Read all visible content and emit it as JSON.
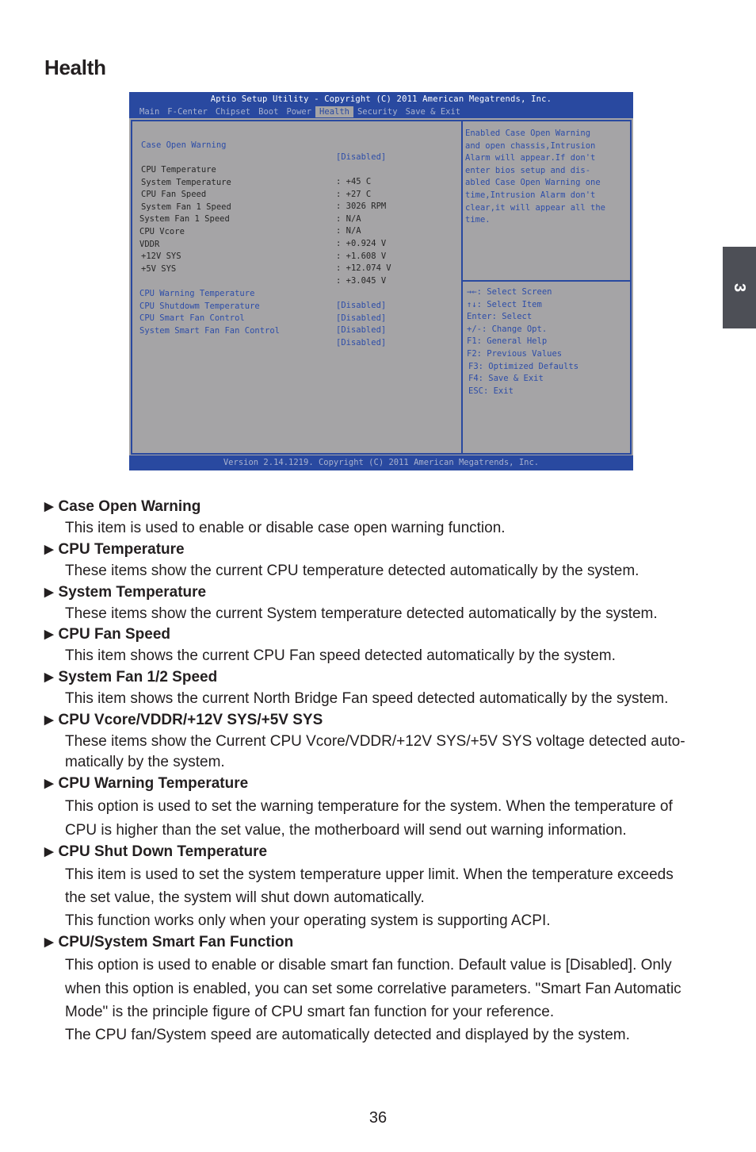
{
  "page": {
    "title": "Health",
    "chapter_tab": "3",
    "page_number": "36"
  },
  "bios": {
    "title": "Aptio Setup Utility - Copyright (C) 2011 American Megatrends, Inc.",
    "menu": [
      {
        "label": "Main",
        "active": false
      },
      {
        "label": "F-Center",
        "active": false
      },
      {
        "label": "Chipset",
        "active": false
      },
      {
        "label": "Boot",
        "active": false
      },
      {
        "label": "Power",
        "active": false
      },
      {
        "label": "Health",
        "active": true
      },
      {
        "label": "Security",
        "active": false
      },
      {
        "label": "Save & Exit",
        "active": false
      }
    ],
    "items": [
      {
        "label": "Case Open Warning",
        "value": "[Disabled]"
      },
      {
        "label": "CPU Temperature",
        "value": ": +45 C"
      },
      {
        "label": "System Temperature",
        "value": ": +27 C"
      },
      {
        "label": "CPU Fan Speed",
        "value": ": 3026 RPM"
      },
      {
        "label": "System Fan 1 Speed",
        "value": ": N/A"
      },
      {
        "label": "System Fan 1 Speed",
        "value": ": N/A"
      },
      {
        "label": "CPU Vcore",
        "value": ": +0.924 V"
      },
      {
        "label": "VDDR",
        "value": ": +1.608 V"
      },
      {
        "label": "+12V SYS",
        "value": ": +12.074 V"
      },
      {
        "label": "+5V SYS",
        "value": ": +3.045 V"
      },
      {
        "label": "CPU Warning Temperature",
        "value": "[Disabled]"
      },
      {
        "label": "CPU Shutdowm Temperature",
        "value": "[Disabled]"
      },
      {
        "label": "CPU Smart Fan Control",
        "value": "[Disabled]"
      },
      {
        "label": "System Smart Fan Fan Control",
        "value": "[Disabled]"
      }
    ],
    "help_text": [
      "Enabled Case Open Warning",
      "and open chassis,Intrusion",
      "Alarm will appear.If don't",
      "enter bios setup and dis-",
      "abled Case Open Warning one",
      "time,Intrusion Alarm don't",
      "clear,it will appear all the",
      "time."
    ],
    "key_help": [
      "→←: Select Screen",
      "↑↓: Select Item",
      "Enter: Select",
      "+/-: Change Opt.",
      "F1: General Help",
      "F2: Previous Values",
      "F3: Optimized Defaults",
      "F4: Save & Exit",
      "ESC: Exit"
    ],
    "footer": "Version 2.14.1219. Copyright (C) 2011 American Megatrends, Inc.",
    "colors": {
      "bar": "#2949a0",
      "panel": "#a5a4a6",
      "highlight_text": "#2d4da8"
    }
  },
  "sections": [
    {
      "heading": "Case Open Warning",
      "lines": [
        "This item is used to enable or disable case open warning function."
      ]
    },
    {
      "heading": "CPU Temperature",
      "lines": [
        "These items show the current CPU temperature detected automatically by the system."
      ]
    },
    {
      "heading": "System Temperature",
      "lines": [
        "These items show the current System temperature detected automatically by the system."
      ]
    },
    {
      "heading": "CPU Fan Speed",
      "lines": [
        "This item shows the current CPU Fan speed detected automatically by the system."
      ]
    },
    {
      "heading": "System Fan 1/2 Speed",
      "lines": [
        "This item shows the current North Bridge Fan speed detected automatically by the system."
      ]
    },
    {
      "heading": "CPU Vcore/VDDR/+12V SYS/+5V SYS",
      "lines": [
        "These items show the Current CPU Vcore/VDDR/+12V SYS/+5V SYS voltage detected auto-",
        "matically by the system."
      ]
    },
    {
      "heading": "CPU Warning Temperature",
      "lines": [
        "This option is used to set the warning temperature for the system. When the temperature of",
        "CPU is higher than the set value, the motherboard will send out warning information."
      ]
    },
    {
      "heading": "CPU Shut Down Temperature",
      "lines": [
        "This item is used to set the system temperature upper limit. When the temperature exceeds",
        "the set value, the system will shut down automatically.",
        "This function works only when your operating system is supporting ACPI."
      ]
    },
    {
      "heading": "CPU/System Smart Fan Function",
      "lines": [
        "This option is used to enable or disable smart fan function. Default value is [Disabled]. Only",
        "when this option is enabled, you can set some correlative parameters. \"Smart Fan Automatic",
        "Mode\" is the principle figure of CPU smart fan function for your reference.",
        "The CPU fan/System speed are automatically detected and displayed by the system."
      ]
    }
  ]
}
